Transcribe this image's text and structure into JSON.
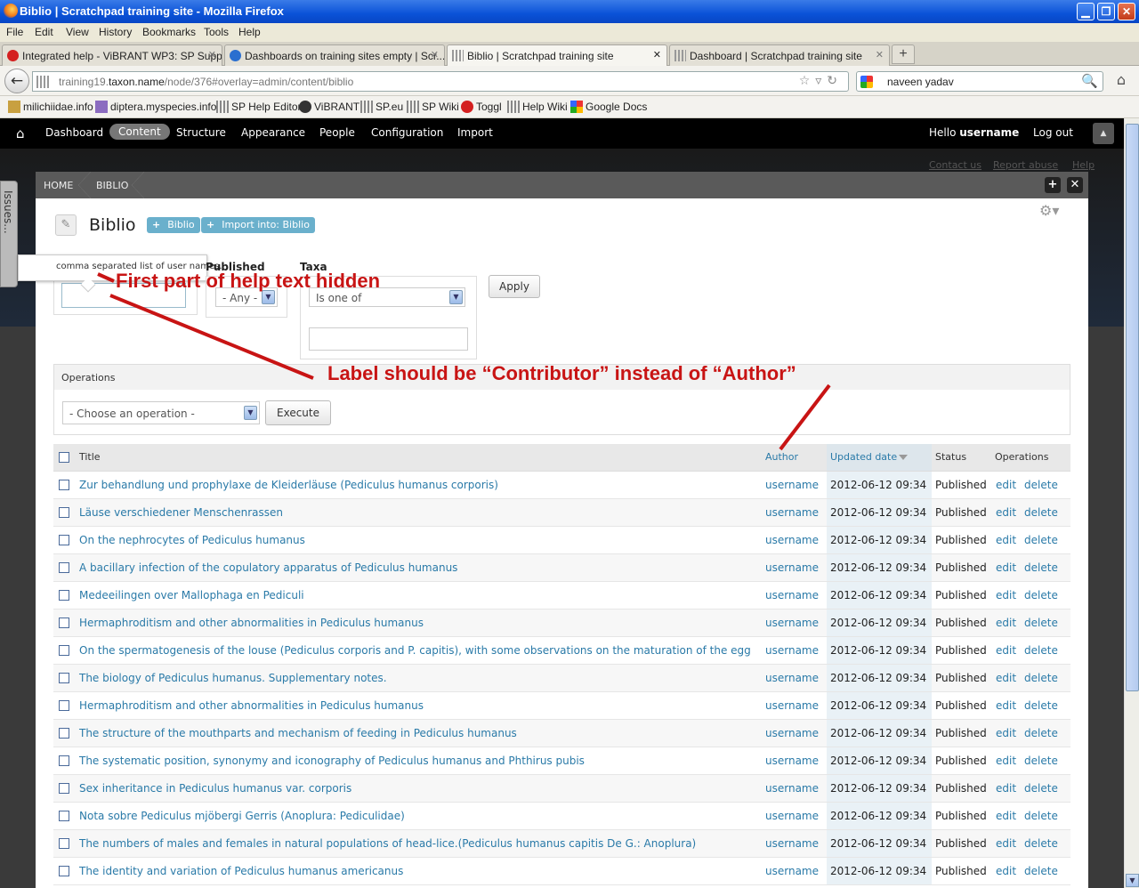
{
  "window": {
    "title": "Biblio | Scratchpad training site - Mozilla Firefox",
    "min": "▁",
    "max": "❐",
    "close": "✕"
  },
  "menu": [
    "File",
    "Edit",
    "View",
    "History",
    "Bookmarks",
    "Tools",
    "Help"
  ],
  "tabs": [
    {
      "label": "Integrated help - ViBRANT WP3: SP Supp...",
      "icon_color": "#d42020"
    },
    {
      "label": "Dashboards on training sites empty | Scr...",
      "icon_color": "#2a6fcf"
    },
    {
      "label": "Biblio | Scratchpad training site",
      "icon_color": "#888888"
    },
    {
      "label": "Dashboard | Scratchpad training site",
      "icon_color": "#888888"
    }
  ],
  "tab_close": "✕",
  "new_tab": "+",
  "address": {
    "prefix": "training19.",
    "host": "taxon.name",
    "path": "/node/376#overlay=admin/content/biblio",
    "icons": "☆▿↻"
  },
  "search": {
    "value": "naveen yadav",
    "icon": "🔍"
  },
  "nav": {
    "back": "←",
    "home": "⌂"
  },
  "bookmarks": [
    {
      "label": "milichiidae.info",
      "icon_color": "#c8a040"
    },
    {
      "label": "diptera.myspecies.info",
      "icon_color": "#8b6cc0"
    },
    {
      "label": "SP Help Editor",
      "icon_color": "#888888"
    },
    {
      "label": "ViBRANT",
      "icon_color": "#333333"
    },
    {
      "label": "SP.eu",
      "icon_color": "#888888"
    },
    {
      "label": "SP Wiki",
      "icon_color": "#888888"
    },
    {
      "label": "Toggl",
      "icon_color": "#d42020"
    },
    {
      "label": "Help Wiki",
      "icon_color": "#888888"
    },
    {
      "label": "Google Docs",
      "icon_color": "#2a9a2a"
    }
  ],
  "toolbar": {
    "home_icon": "⌂",
    "items": [
      "Dashboard",
      "Content",
      "Structure",
      "Appearance",
      "People",
      "Configuration",
      "Import"
    ],
    "active": "Content",
    "hello_prefix": "Hello ",
    "username": "username",
    "logout": "Log out",
    "toggle": "▲"
  },
  "bg_links": [
    "Contact us",
    "Report abuse",
    "Help"
  ],
  "issues_tab": "Issues...",
  "breadcrumb": [
    "HOME",
    "BIBLIO"
  ],
  "overlay_buttons": {
    "add": "+",
    "close": "✕"
  },
  "page": {
    "icon": "✎",
    "title": "Biblio",
    "actions": [
      {
        "plus": "+",
        "label": "Biblio"
      },
      {
        "plus": "+",
        "label": "Import into: Biblio"
      }
    ],
    "gear": "⚙▾"
  },
  "filters": {
    "help_text": "comma separated list of user names.",
    "published_label": "Published",
    "published_value": "- Any -",
    "taxa_label": "Taxa",
    "taxa_value": "Is one of",
    "apply": "Apply",
    "arrow": "▼"
  },
  "operations": {
    "label": "Operations",
    "select": "- Choose an operation -",
    "execute": "Execute"
  },
  "table": {
    "headers": {
      "title": "Title",
      "author": "Author",
      "updated": "Updated date",
      "status": "Status",
      "operations": "Operations"
    },
    "rows": [
      {
        "title": "Zur behandlung und prophylaxe de Kleiderläuse (Pediculus humanus corporis)",
        "author": "username",
        "date": "2012-06-12 09:34",
        "status": "Published",
        "edit": "edit",
        "delete": "delete"
      },
      {
        "title": "Läuse verschiedener Menschenrassen",
        "author": "username",
        "date": "2012-06-12 09:34",
        "status": "Published",
        "edit": "edit",
        "delete": "delete"
      },
      {
        "title": "On the nephrocytes of Pediculus humanus",
        "author": "username",
        "date": "2012-06-12 09:34",
        "status": "Published",
        "edit": "edit",
        "delete": "delete"
      },
      {
        "title": "A bacillary infection of the copulatory apparatus of Pediculus humanus",
        "author": "username",
        "date": "2012-06-12 09:34",
        "status": "Published",
        "edit": "edit",
        "delete": "delete"
      },
      {
        "title": "Medeeilingen over Mallophaga en Pediculi",
        "author": "username",
        "date": "2012-06-12 09:34",
        "status": "Published",
        "edit": "edit",
        "delete": "delete"
      },
      {
        "title": "Hermaphroditism and other abnormalities in Pediculus humanus",
        "author": "username",
        "date": "2012-06-12 09:34",
        "status": "Published",
        "edit": "edit",
        "delete": "delete"
      },
      {
        "title": "On the spermatogenesis of the louse (Pediculus corporis and P. capitis), with some observations on the maturation of the egg",
        "author": "username",
        "date": "2012-06-12 09:34",
        "status": "Published",
        "edit": "edit",
        "delete": "delete"
      },
      {
        "title": "The biology of Pediculus humanus. Supplementary notes.",
        "author": "username",
        "date": "2012-06-12 09:34",
        "status": "Published",
        "edit": "edit",
        "delete": "delete"
      },
      {
        "title": "Hermaphroditism and other abnormalities in Pediculus humanus",
        "author": "username",
        "date": "2012-06-12 09:34",
        "status": "Published",
        "edit": "edit",
        "delete": "delete"
      },
      {
        "title": "The structure of the mouthparts and mechanism of feeding in Pediculus humanus",
        "author": "username",
        "date": "2012-06-12 09:34",
        "status": "Published",
        "edit": "edit",
        "delete": "delete"
      },
      {
        "title": "The systematic position, synonymy and iconography of Pediculus humanus and Phthirus pubis",
        "author": "username",
        "date": "2012-06-12 09:34",
        "status": "Published",
        "edit": "edit",
        "delete": "delete"
      },
      {
        "title": "Sex inheritance in Pediculus humanus var. corporis",
        "author": "username",
        "date": "2012-06-12 09:34",
        "status": "Published",
        "edit": "edit",
        "delete": "delete"
      },
      {
        "title": "Nota sobre Pediculus mjöbergi Gerris (Anoplura: Pediculidae)",
        "author": "username",
        "date": "2012-06-12 09:34",
        "status": "Published",
        "edit": "edit",
        "delete": "delete"
      },
      {
        "title": "The numbers of males and females in natural populations of head-lice.(Pediculus humanus capitis De G.: Anoplura)",
        "author": "username",
        "date": "2012-06-12 09:34",
        "status": "Published",
        "edit": "edit",
        "delete": "delete"
      },
      {
        "title": "The identity and variation of Pediculus humanus americanus",
        "author": "username",
        "date": "2012-06-12 09:34",
        "status": "Published",
        "edit": "edit",
        "delete": "delete"
      }
    ]
  },
  "annotations": {
    "help_text_hidden": "First part of help text hidden",
    "label_note": "Label should be “Contributor” instead of “Author”",
    "color": "#c81414"
  },
  "scroll": {
    "up": "▲",
    "down": "▼"
  }
}
